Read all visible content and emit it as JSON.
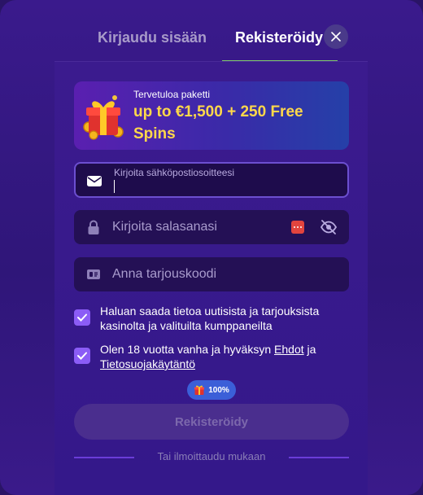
{
  "tabs": {
    "login_label": "Kirjaudu sisään",
    "register_label": "Rekisteröidy"
  },
  "banner": {
    "subtitle": "Tervetuloa paketti",
    "title": "up to €1,500 + 250 Free Spins"
  },
  "form": {
    "email_label": "Kirjoita sähköpostiosoitteesi",
    "email_value": "",
    "password_placeholder": "Kirjoita salasanasi",
    "promo_placeholder": "Anna tarjouskoodi"
  },
  "consents": {
    "marketing_text": "Haluan saada tietoa uutisista ja tarjouksista kasinolta ja valituilta kumppaneilta",
    "marketing_checked": true,
    "terms_prefix": "Olen 18 vuotta vanha ja hyväksyn ",
    "terms_link": "Ehdot",
    "terms_mid": " ja ",
    "privacy_link": "Tietosuojakäytäntö",
    "terms_checked": true
  },
  "progress_badge": "100%",
  "submit_label": "Rekisteröidy",
  "social_divider": "Tai ilmoittaudu mukaan",
  "colors": {
    "accent": "#8b5cf6",
    "tab_underline": "#7fc86a",
    "banner_title": "#ffd84a"
  }
}
